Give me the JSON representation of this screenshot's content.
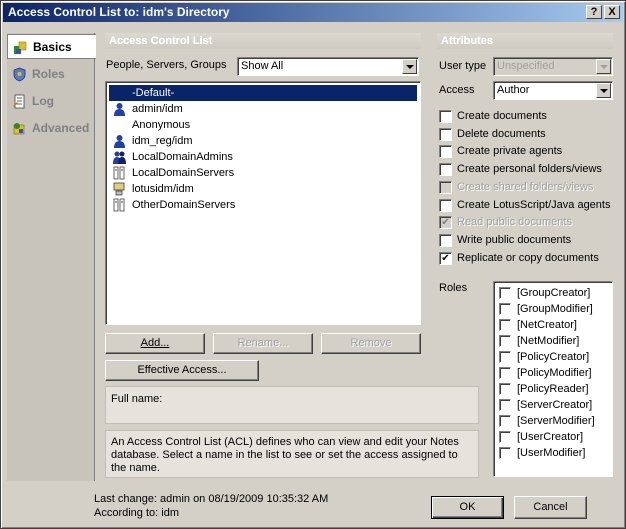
{
  "window": {
    "title": "Access Control List to: idm's Directory",
    "help_btn": "?",
    "close_btn": "X"
  },
  "nav": [
    {
      "label": "Basics",
      "icon": "basics-icon",
      "active": true
    },
    {
      "label": "Roles",
      "icon": "roles-icon",
      "active": false
    },
    {
      "label": "Log",
      "icon": "log-icon",
      "active": false
    },
    {
      "label": "Advanced",
      "icon": "advanced-icon",
      "active": false
    }
  ],
  "acl": {
    "header": "Access Control List",
    "filter_label": "People, Servers, Groups",
    "filter_value": "Show All",
    "entries": [
      {
        "name": "-Default-",
        "icon": "",
        "selected": true
      },
      {
        "name": "admin/idm",
        "icon": "person-icon",
        "selected": false
      },
      {
        "name": "Anonymous",
        "icon": "",
        "selected": false
      },
      {
        "name": "idm_reg/idm",
        "icon": "person-icon",
        "selected": false
      },
      {
        "name": "LocalDomainAdmins",
        "icon": "group-icon",
        "selected": false
      },
      {
        "name": "LocalDomainServers",
        "icon": "server-group-icon",
        "selected": false
      },
      {
        "name": "lotusidm/idm",
        "icon": "server-icon",
        "selected": false
      },
      {
        "name": "OtherDomainServers",
        "icon": "server-group-icon",
        "selected": false
      }
    ],
    "buttons": {
      "add": "Add...",
      "rename": "Rename...",
      "remove": "Remove",
      "effective": "Effective Access..."
    },
    "full_name_label": "Full name:",
    "description": "An Access Control List (ACL) defines who can view and edit your Notes database.  Select a name in the list to see or set the access assigned to the name."
  },
  "attributes": {
    "header": "Attributes",
    "user_type_label": "User type",
    "user_type_value": "Unspecified",
    "access_label": "Access",
    "access_value": "Author",
    "options": [
      {
        "label": "Create documents",
        "checked": false,
        "disabled": false
      },
      {
        "label": "Delete documents",
        "checked": false,
        "disabled": false
      },
      {
        "label": "Create private agents",
        "checked": false,
        "disabled": false
      },
      {
        "label": "Create personal folders/views",
        "checked": false,
        "disabled": false
      },
      {
        "label": "Create shared folders/views",
        "checked": false,
        "disabled": true
      },
      {
        "label": "Create LotusScript/Java agents",
        "checked": false,
        "disabled": false
      },
      {
        "label": "Read public documents",
        "checked": true,
        "disabled": true
      },
      {
        "label": "Write public documents",
        "checked": false,
        "disabled": false
      },
      {
        "label": "Replicate or copy documents",
        "checked": true,
        "disabled": false
      }
    ],
    "roles_label": "Roles",
    "roles": [
      "[GroupCreator]",
      "[GroupModifier]",
      "[NetCreator]",
      "[NetModifier]",
      "[PolicyCreator]",
      "[PolicyModifier]",
      "[PolicyReader]",
      "[ServerCreator]",
      "[ServerModifier]",
      "[UserCreator]",
      "[UserModifier]"
    ]
  },
  "footer": {
    "last_change": "Last change: admin on 08/19/2009 10:35:32 AM",
    "according_to": "According to: idm",
    "ok": "OK",
    "cancel": "Cancel"
  }
}
